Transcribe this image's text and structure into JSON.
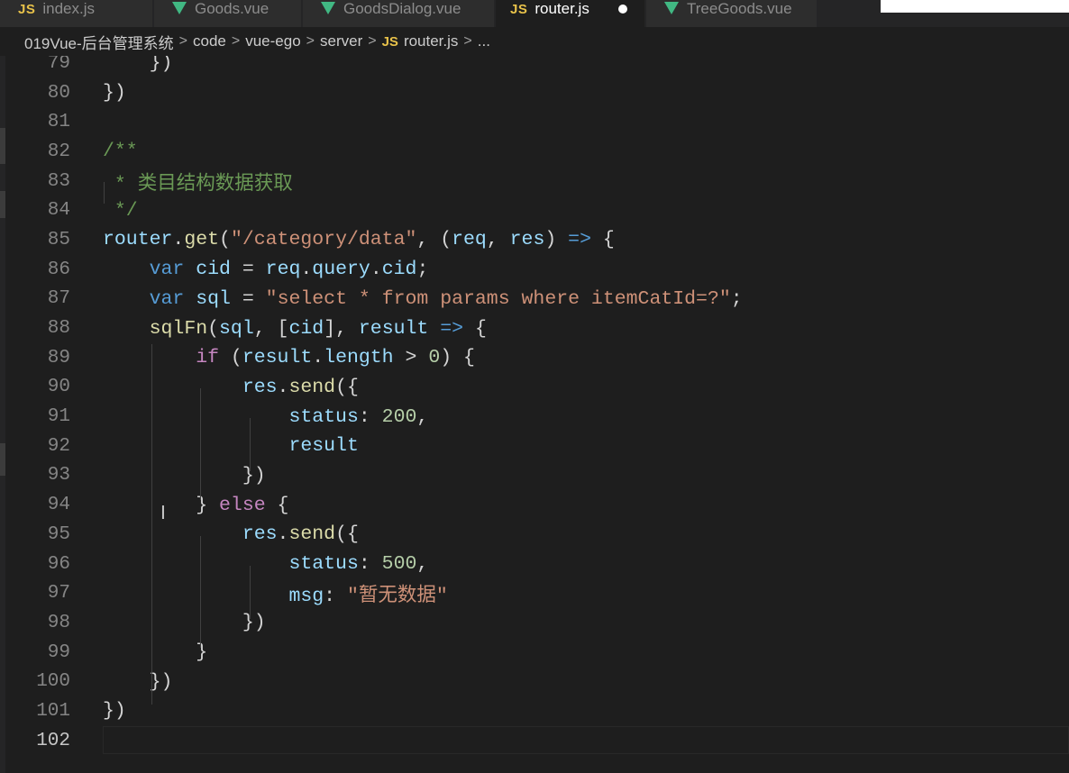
{
  "tabs": [
    {
      "label": "index.js",
      "type": "js",
      "active": false
    },
    {
      "label": "Goods.vue",
      "type": "vue",
      "active": false
    },
    {
      "label": "GoodsDialog.vue",
      "type": "vue",
      "active": false
    },
    {
      "label": "router.js",
      "type": "js",
      "active": true,
      "dirty": true
    },
    {
      "label": "TreeGoods.vue",
      "type": "vue",
      "active": false
    }
  ],
  "icon_labels": {
    "js": "JS"
  },
  "breadcrumb": {
    "items": [
      "019Vue-后台管理系统",
      "code",
      "vue-ego",
      "server",
      "router.js",
      "..."
    ],
    "separator": ">"
  },
  "colors": {
    "editor_bg": "#1e1e1e",
    "tabbar_bg": "#252526",
    "js_icon": "#e8c24a",
    "vue_icon": "#41b883",
    "keyword": "#569cd6",
    "control": "#c586c0",
    "function": "#dcdcaa",
    "variable": "#9cdcfe",
    "string": "#ce9178",
    "number": "#b5cea8",
    "comment": "#6a9955"
  },
  "editor": {
    "current_line": 102,
    "lines": [
      {
        "n": "79",
        "tokens": [
          [
            "p",
            "    })"
          ]
        ]
      },
      {
        "n": "80",
        "tokens": [
          [
            "p",
            "})"
          ]
        ]
      },
      {
        "n": "81",
        "tokens": []
      },
      {
        "n": "82",
        "tokens": [
          [
            "c",
            "/**"
          ]
        ]
      },
      {
        "n": "83",
        "tokens": [
          [
            "c",
            " * 类目结构数据获取"
          ]
        ]
      },
      {
        "n": "84",
        "tokens": [
          [
            "c",
            " */"
          ]
        ]
      },
      {
        "n": "85",
        "tokens": [
          [
            "v",
            "router"
          ],
          [
            "p",
            "."
          ],
          [
            "f",
            "get"
          ],
          [
            "p",
            "("
          ],
          [
            "s",
            "\"/category/data\""
          ],
          [
            "p",
            ", ("
          ],
          [
            "v",
            "req"
          ],
          [
            "p",
            ", "
          ],
          [
            "v",
            "res"
          ],
          [
            "p",
            ") "
          ],
          [
            "k",
            "=>"
          ],
          [
            "p",
            " {"
          ]
        ]
      },
      {
        "n": "86",
        "tokens": [
          [
            "p",
            "    "
          ],
          [
            "k",
            "var"
          ],
          [
            "p",
            " "
          ],
          [
            "v",
            "cid"
          ],
          [
            "p",
            " = "
          ],
          [
            "v",
            "req"
          ],
          [
            "p",
            "."
          ],
          [
            "v",
            "query"
          ],
          [
            "p",
            "."
          ],
          [
            "v",
            "cid"
          ],
          [
            "p",
            ";"
          ]
        ]
      },
      {
        "n": "87",
        "tokens": [
          [
            "p",
            "    "
          ],
          [
            "k",
            "var"
          ],
          [
            "p",
            " "
          ],
          [
            "v",
            "sql"
          ],
          [
            "p",
            " = "
          ],
          [
            "s",
            "\"select * from params where itemCatId=?\""
          ],
          [
            "p",
            ";"
          ]
        ]
      },
      {
        "n": "88",
        "tokens": [
          [
            "p",
            "    "
          ],
          [
            "f",
            "sqlFn"
          ],
          [
            "p",
            "("
          ],
          [
            "v",
            "sql"
          ],
          [
            "p",
            ", ["
          ],
          [
            "v",
            "cid"
          ],
          [
            "p",
            "], "
          ],
          [
            "v",
            "result"
          ],
          [
            "p",
            " "
          ],
          [
            "k",
            "=>"
          ],
          [
            "p",
            " {"
          ]
        ]
      },
      {
        "n": "89",
        "tokens": [
          [
            "p",
            "        "
          ],
          [
            "x",
            "if"
          ],
          [
            "p",
            " ("
          ],
          [
            "v",
            "result"
          ],
          [
            "p",
            "."
          ],
          [
            "v",
            "length"
          ],
          [
            "p",
            " > "
          ],
          [
            "n",
            "0"
          ],
          [
            "p",
            ") {"
          ]
        ]
      },
      {
        "n": "90",
        "tokens": [
          [
            "p",
            "            "
          ],
          [
            "v",
            "res"
          ],
          [
            "p",
            "."
          ],
          [
            "f",
            "send"
          ],
          [
            "p",
            "({"
          ]
        ]
      },
      {
        "n": "91",
        "tokens": [
          [
            "p",
            "                "
          ],
          [
            "v",
            "status"
          ],
          [
            "p",
            ": "
          ],
          [
            "n",
            "200"
          ],
          [
            "p",
            ","
          ]
        ]
      },
      {
        "n": "92",
        "tokens": [
          [
            "p",
            "                "
          ],
          [
            "v",
            "result"
          ]
        ]
      },
      {
        "n": "93",
        "tokens": [
          [
            "p",
            "            })"
          ]
        ]
      },
      {
        "n": "94",
        "tokens": [
          [
            "p",
            "        } "
          ],
          [
            "x",
            "else"
          ],
          [
            "p",
            " {"
          ]
        ]
      },
      {
        "n": "95",
        "tokens": [
          [
            "p",
            "            "
          ],
          [
            "v",
            "res"
          ],
          [
            "p",
            "."
          ],
          [
            "f",
            "send"
          ],
          [
            "p",
            "({"
          ]
        ]
      },
      {
        "n": "96",
        "tokens": [
          [
            "p",
            "                "
          ],
          [
            "v",
            "status"
          ],
          [
            "p",
            ": "
          ],
          [
            "n",
            "500"
          ],
          [
            "p",
            ","
          ]
        ]
      },
      {
        "n": "97",
        "tokens": [
          [
            "p",
            "                "
          ],
          [
            "v",
            "msg"
          ],
          [
            "p",
            ": "
          ],
          [
            "s",
            "\"暂无数据\""
          ]
        ]
      },
      {
        "n": "98",
        "tokens": [
          [
            "p",
            "            })"
          ]
        ]
      },
      {
        "n": "99",
        "tokens": [
          [
            "p",
            "        }"
          ]
        ]
      },
      {
        "n": "100",
        "tokens": [
          [
            "p",
            "    })"
          ]
        ]
      },
      {
        "n": "101",
        "tokens": [
          [
            "p",
            "})"
          ]
        ]
      },
      {
        "n": "102",
        "tokens": []
      }
    ]
  }
}
